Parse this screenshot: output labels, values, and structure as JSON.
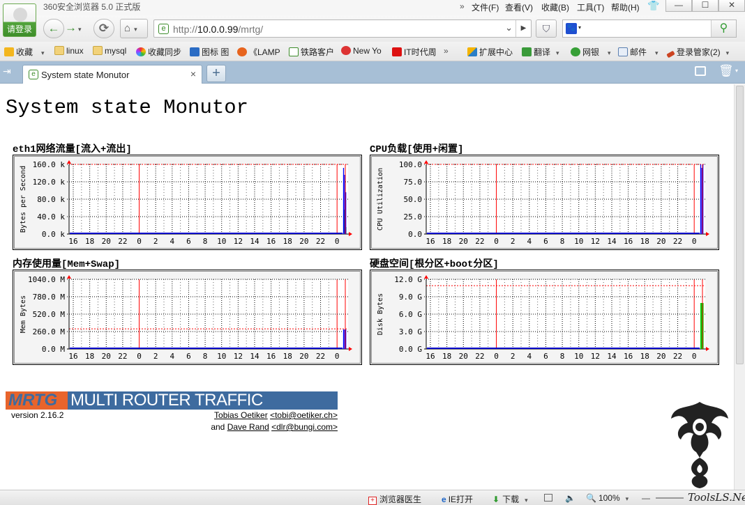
{
  "browser": {
    "title": "360安全浏览器 5.0 正式版",
    "menus": [
      "文件(F)",
      "查看(V)",
      "收藏(B)",
      "工具(T)",
      "帮助(H)"
    ],
    "window_buttons": {
      "minimize": "—",
      "maximize": "☐",
      "close": "✕"
    },
    "login_label": "请登录",
    "address": {
      "prefix": "http://",
      "host": "10.0.0.99",
      "path": "/mrtg/"
    },
    "search_placeholder": "",
    "bookmarks": [
      "收藏",
      "linux",
      "mysql",
      "收藏同步",
      "图标 图",
      "《LAMP",
      "铁路客户",
      "New Yo",
      "IT时代周",
      "扩展中心",
      "翻译",
      "网银",
      "邮件",
      "登录管家(2)"
    ],
    "tab": {
      "title": "System state Monutor",
      "close": "×",
      "new": "+"
    },
    "status": {
      "doctor": "浏览器医生",
      "ie_open": "IE打开",
      "download": "下载",
      "zoom": "100%",
      "watermark": "ToolsLS.Net"
    }
  },
  "page": {
    "title": "System state Monutor",
    "graphs": [
      {
        "title": "eth1网络流量[流入+流出]",
        "ylabel": "Bytes per Second",
        "yticks": [
          "0.0 k",
          "40.0 k",
          "80.0 k",
          "120.0 k",
          "160.0 k"
        ],
        "ymax": 160,
        "max_line": 160,
        "spike_in": [
          0.35,
          0.25,
          0.1
        ],
        "spike_out": [
          0.95,
          0.85,
          0.6
        ]
      },
      {
        "title": "CPU负载[使用+闲置]",
        "ylabel": "CPU Utilization",
        "yticks": [
          "0.0",
          "25.0",
          "50.0",
          "75.0",
          "100.0"
        ],
        "ymax": 100,
        "max_line": 100,
        "spike_in": [
          0,
          0,
          0
        ],
        "spike_out": [
          1.0,
          0.95,
          1.0
        ]
      },
      {
        "title": "内存使用量[Mem+Swap]",
        "ylabel": "Mem Bytes",
        "yticks": [
          "0.0 M",
          "260.0 M",
          "520.0 M",
          "780.0 M",
          "1040.0 M"
        ],
        "ymax": 1040,
        "max_line": 300,
        "spike_in": [
          0,
          0,
          0
        ],
        "spike_out": [
          0.28,
          0.28,
          0.28
        ]
      },
      {
        "title": "硬盘空间[根分区+boot分区]",
        "ylabel": "Disk Bytes",
        "yticks": [
          "0.0 G",
          "3.0 G",
          "6.0 G",
          "9.0 G",
          "12.0 G"
        ],
        "ymax": 12,
        "max_line": 10.9,
        "spike_in": [
          0.66,
          0.66,
          0.66
        ],
        "spike_out": [
          0,
          0,
          0
        ]
      }
    ],
    "xticks": [
      "16",
      "18",
      "20",
      "22",
      "0",
      "2",
      "4",
      "6",
      "8",
      "10",
      "12",
      "14",
      "16",
      "18",
      "20",
      "22",
      "0"
    ]
  },
  "mrtg": {
    "logo": "MRTG",
    "name": "MULTI ROUTER TRAFFIC GRAPHER",
    "version": "version 2.16.2",
    "author1": "Tobias Oetiker",
    "email1": "<tobi@oetiker.ch>",
    "and": "and",
    "author2": "Dave Rand",
    "email2": "<dlr@bungi.com>"
  },
  "colors": {
    "accent_green": "#3a8f2e",
    "tab_bar": "#a7bfd6",
    "mrtg_blue": "#3e6b9f",
    "mrtg_orange": "#e8642c",
    "in_green": "#00cc00",
    "out_blue": "#0000ff"
  }
}
